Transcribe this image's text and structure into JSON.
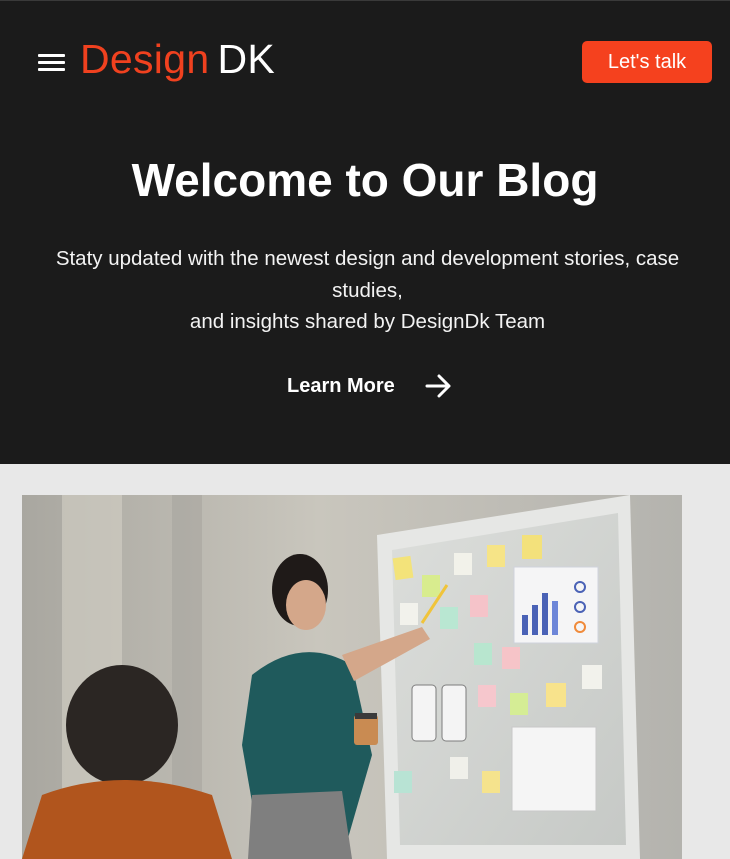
{
  "header": {
    "menu_icon": "hamburger-menu-icon",
    "logo": {
      "part1": "Design",
      "part2": "DK"
    },
    "cta_label": "Let's talk"
  },
  "hero": {
    "title": "Welcome to Our Blog",
    "subtitle_line1": "Staty updated with the newest design and development stories, case studies,",
    "subtitle_line2": "and insights shared by DesignDk Team",
    "learn_more_label": "Learn More",
    "learn_more_icon": "arrow-right-icon"
  },
  "featured_image": {
    "alt": "Woman presenting at a glass board covered with sticky notes"
  },
  "colors": {
    "brand_orange": "#f5411e",
    "hero_bg": "#1b1b1b",
    "page_bg": "#e8e8e8"
  }
}
